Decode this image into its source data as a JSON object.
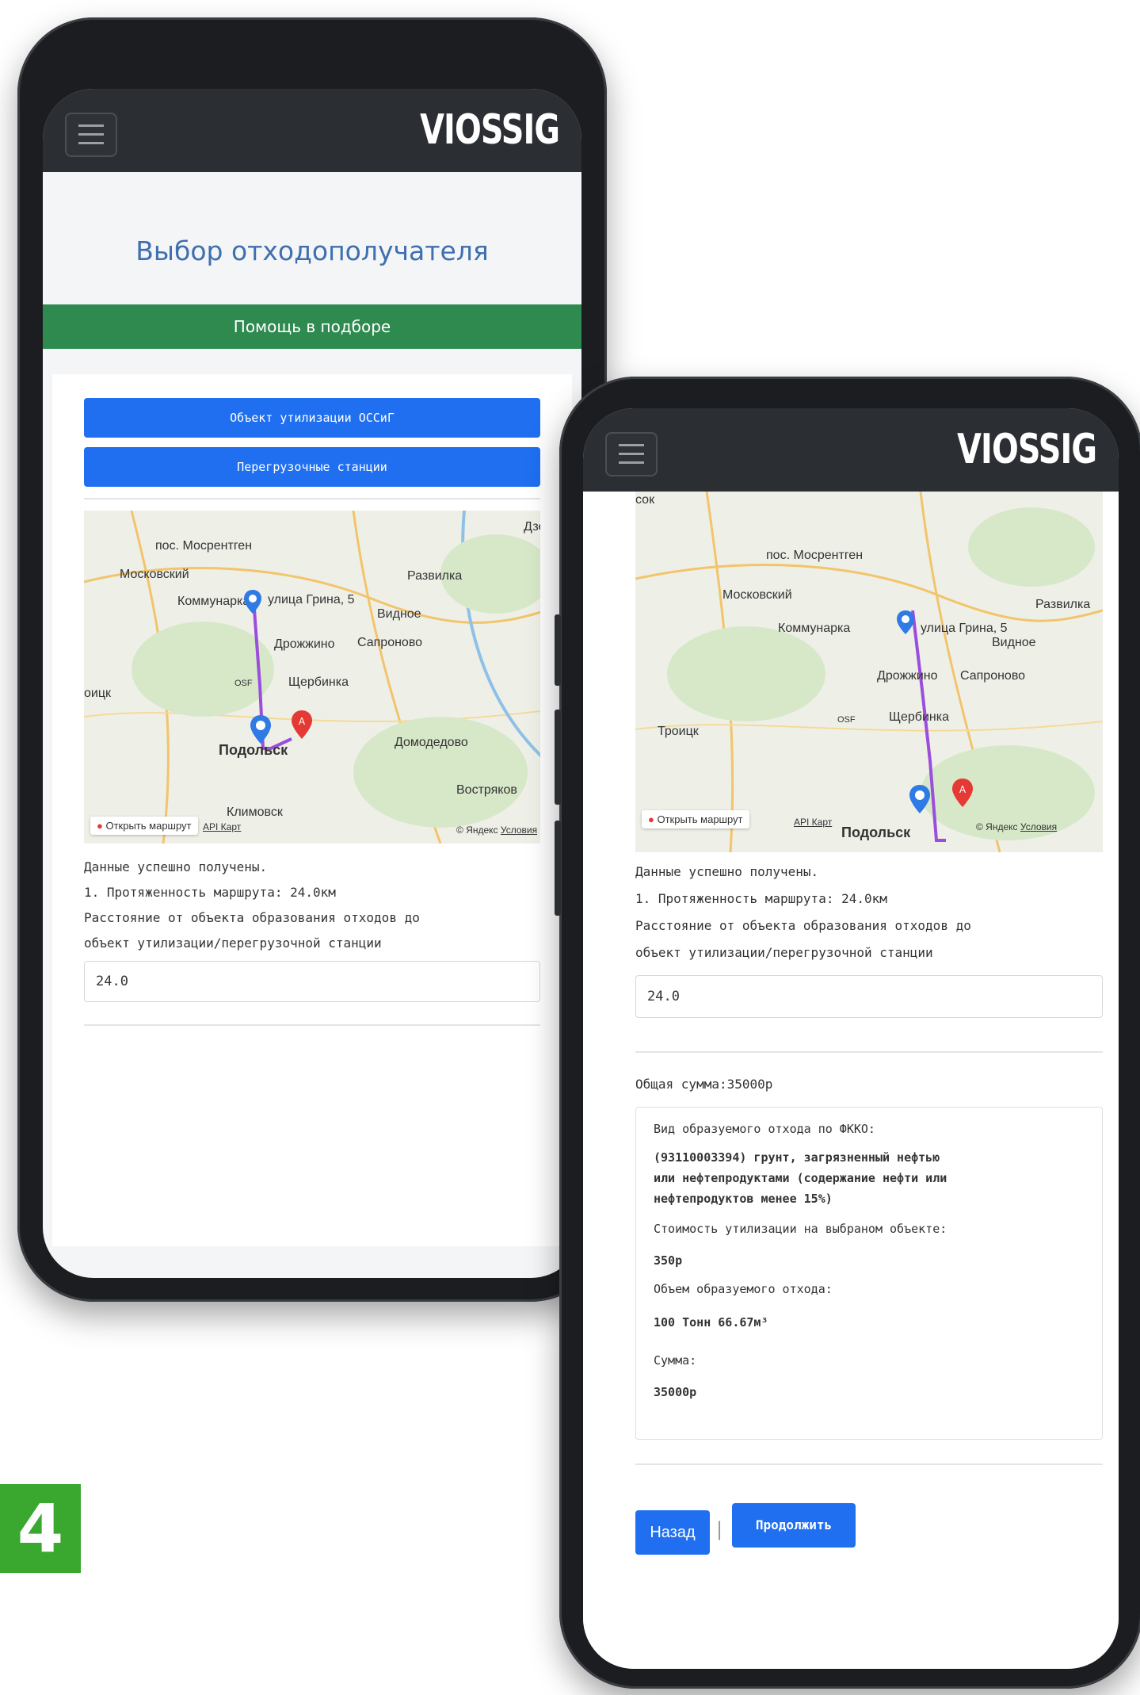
{
  "badge": "4",
  "logo": "VIOSSIG",
  "phone_left": {
    "title": "Выбор отходополучателя",
    "help_button": "Помощь в подборе",
    "buttons": [
      "Объект утилизации ОССиГ",
      "Перегрузочные станции"
    ],
    "map": {
      "labels": [
        "пос. Мосрентген",
        "Дзерж",
        "Московский",
        "Развилка",
        "Коммунарка",
        "улица Грина, 5",
        "Видное",
        "Дрожжино",
        "Сапроново",
        "OSF",
        "Щербинка",
        "оицк",
        "Подольск",
        "Домодедово",
        "Востряков",
        "Климовск"
      ],
      "open_route": "Открыть маршрут",
      "api_link": "API Карт",
      "copyright": "© Яндекс",
      "terms": "Условия"
    },
    "status_lines": [
      "Данные успешно получены.",
      "1. Протяженность маршрута: 24.0км",
      "Расстояние от объекта образования отходов до",
      "объект утилизации/перегрузочной станции"
    ],
    "distance_value": "24.0"
  },
  "phone_right": {
    "map": {
      "labels": [
        "сок",
        "пос. Мосрентген",
        "Московский",
        "Развилка",
        "Коммунарка",
        "улица Грина, 5",
        "Видное",
        "Дрожжино",
        "Сапроново",
        "Троицк",
        "OSF",
        "Щербинка",
        "Подольск"
      ],
      "open_route": "Открыть маршрут",
      "api_link": "API Карт",
      "copyright": "© Яндекс",
      "terms": "Условия"
    },
    "status_lines": [
      "Данные успешно получены.",
      "1. Протяженность маршрута: 24.0км",
      "Расстояние от объекта образования отходов до",
      "объект утилизации/перегрузочной станции"
    ],
    "distance_value": "24.0",
    "total": "Общая сумма:35000р",
    "details": {
      "fkko_label": "Вид образуемого отхода по ФККО:",
      "fkko_value_lines": [
        "(93110003394) грунт, загрязненный нефтью",
        "или нефтепродуктами (содержание нефти или",
        "нефтепродуктов менее 15%)"
      ],
      "cost_label": "Стоимость утилизации на выбраном объекте:",
      "cost_value": "350р",
      "volume_label": "Объем образуемого отхода:",
      "volume_value": "100 Тонн 66.67м³",
      "sum_label": "Сумма:",
      "sum_value": "35000р"
    },
    "back_button": "Назад",
    "separator": "|",
    "continue_button": "Продолжить"
  }
}
